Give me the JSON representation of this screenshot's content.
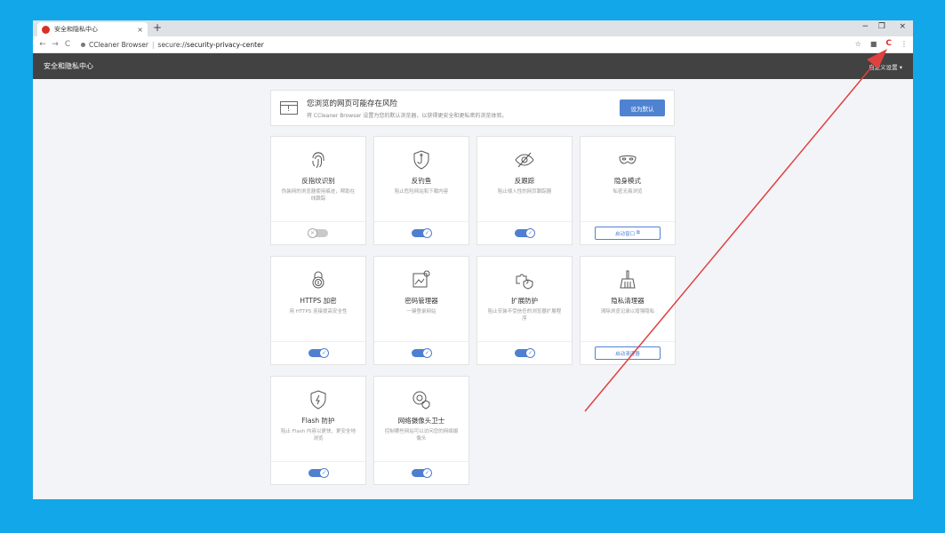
{
  "browser": {
    "tab_title": "安全和隐私中心",
    "tab_close": "×",
    "new_tab": "+",
    "url_brand": "CCleaner Browser",
    "url_separator": "|",
    "url_scheme": "secure://",
    "url_path": "security-privacy-center",
    "win_min": "−",
    "win_max": "❐",
    "win_close": "×"
  },
  "app": {
    "title": "安全和隐私中心",
    "customize": "自定义设置"
  },
  "banner": {
    "heading": "您浏览的网页可能存在风险",
    "subtext": "将 CCleaner Browser 设置为您的默认浏览器，以获得更安全和更私密的浏览体验。",
    "button": "设为默认"
  },
  "cards": [
    {
      "name": "反指纹识别",
      "desc": "伪装网的浏览器使用痕迹，帮助在线跟踪",
      "footer": "toggle",
      "state": "off"
    },
    {
      "name": "反钓鱼",
      "desc": "阻止危险网站和下载内容",
      "footer": "toggle",
      "state": "on"
    },
    {
      "name": "反跟踪",
      "desc": "阻止侵入性的网页跟踪器",
      "footer": "toggle",
      "state": "on"
    },
    {
      "name": "隐身模式",
      "desc": "私密无痕浏览",
      "footer": "button",
      "button": "启动窗口"
    },
    {
      "name": "HTTPS 加密",
      "desc": "用 HTTPS 连接提高安全性",
      "footer": "toggle",
      "state": "on"
    },
    {
      "name": "密码管理器",
      "desc": "一键登录网站",
      "footer": "toggle",
      "state": "on"
    },
    {
      "name": "扩展防护",
      "desc": "阻止安装不受信任的浏览器扩展程序",
      "footer": "toggle",
      "state": "on"
    },
    {
      "name": "隐私清理器",
      "desc": "清除浏览记录以增强隐私",
      "footer": "button",
      "button": "启动清理器"
    },
    {
      "name": "Flash 防护",
      "desc": "阻止 Flash 内容以更快、更安全地浏览",
      "footer": "toggle",
      "state": "on"
    },
    {
      "name": "网络摄像头卫士",
      "desc": "控制哪些网站可以访问您的网络摄像头",
      "footer": "toggle",
      "state": "on"
    }
  ],
  "colors": {
    "background": "#12a7e8",
    "accent": "#4f83d1",
    "header": "#424242",
    "annotation_arrow": "#e04040"
  }
}
